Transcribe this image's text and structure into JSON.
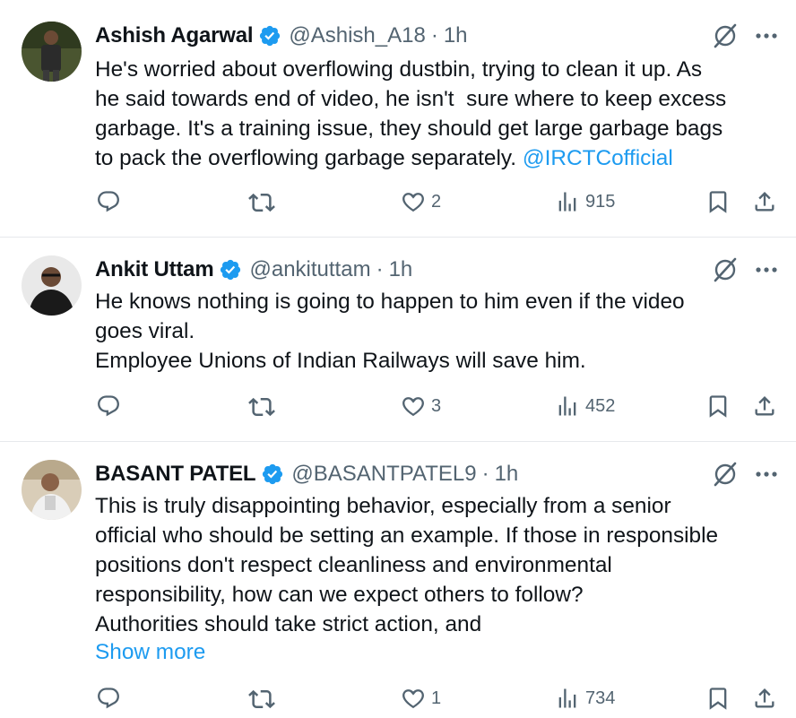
{
  "tweets": [
    {
      "name": "Ashish Agarwal",
      "handle": "@Ashish_A18",
      "separator": "·",
      "time": "1h",
      "text": "He's worried about overflowing dustbin, trying to clean it up. As\nhe said towards end of video, he isn't  sure where to keep excess\ngarbage. It's a training issue, they should get large garbage bags\nto pack the overflowing garbage separately. ",
      "mention": "@IRCTCofficial",
      "likes": "2",
      "views": "915",
      "avatar_colors": {
        "bg": "#3d4a2a",
        "figure": "#2b2b2b"
      }
    },
    {
      "name": "Ankit Uttam",
      "handle": "@ankituttam",
      "separator": "·",
      "time": "1h",
      "text": "He knows nothing is going to happen to him even if the video\ngoes viral.\nEmployee Unions of Indian Railways will save him.",
      "likes": "3",
      "views": "452",
      "avatar_colors": {
        "bg": "#e9e9e9",
        "figure": "#1a1a1a"
      }
    },
    {
      "name": "BASANT PATEL",
      "handle": "@BASANTPATEL9",
      "separator": "·",
      "time": "1h",
      "text": "This is truly disappointing behavior, especially from a senior\nofficial who should be setting an example. If those in responsible\npositions don't respect cleanliness and environmental\nresponsibility, how can we expect others to follow?\nAuthorities should take strict action, and",
      "show_more": "Show more",
      "likes": "1",
      "views": "734",
      "avatar_colors": {
        "bg": "#d9cdb8",
        "figure": "#f1f1f1"
      }
    }
  ],
  "icons": {
    "verified": "verified-badge-icon",
    "grok": "grok-icon",
    "more": "more-options-icon",
    "reply": "reply-icon",
    "repost": "repost-icon",
    "like": "heart-icon",
    "views": "views-chart-icon",
    "bookmark": "bookmark-icon",
    "share": "share-icon"
  },
  "colors": {
    "accent": "#1d9bf0",
    "muted": "#536471",
    "text": "#0f1419",
    "divider": "#e6e9ec"
  }
}
